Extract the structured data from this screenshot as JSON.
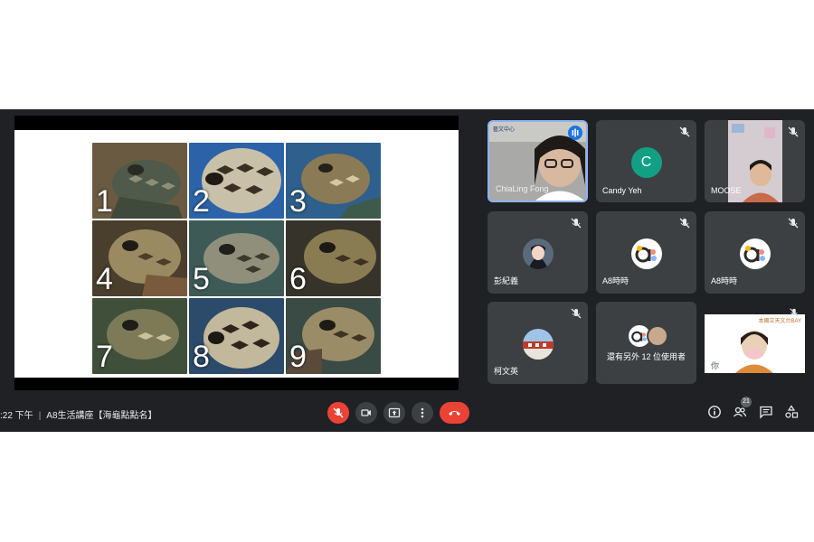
{
  "meeting": {
    "time": ":22 下午",
    "separator": "|",
    "title": "A8生活講座【海龜點點名】"
  },
  "slide": {
    "numbers": [
      "1",
      "2",
      "3",
      "4",
      "5",
      "6",
      "7",
      "8",
      "9"
    ]
  },
  "participants": [
    {
      "name": "ChiaLing Fong",
      "logo_text": "藝文中心",
      "speaking": true
    },
    {
      "name": "Candy Yeh",
      "initial": "C",
      "avatar_color": "#12a085"
    },
    {
      "name": "MOOSE"
    },
    {
      "name": "彭紀義"
    },
    {
      "name": "A8時時"
    },
    {
      "name": "A8時時"
    },
    {
      "name": "柯文英"
    },
    {
      "name": "還有另外 12 位使用者"
    },
    {
      "name": "你",
      "banner_text": "本國立天文台BAY"
    }
  ],
  "people_count": "21",
  "colors": {
    "background": "#202124",
    "tile": "#3c4043",
    "danger": "#ea4335",
    "accent": "#1a73e8"
  },
  "icons": [
    "mic-off-icon",
    "camera-icon",
    "present-icon",
    "more-vert-icon",
    "call-end-icon",
    "info-icon",
    "people-icon",
    "chat-icon",
    "activities-icon"
  ]
}
